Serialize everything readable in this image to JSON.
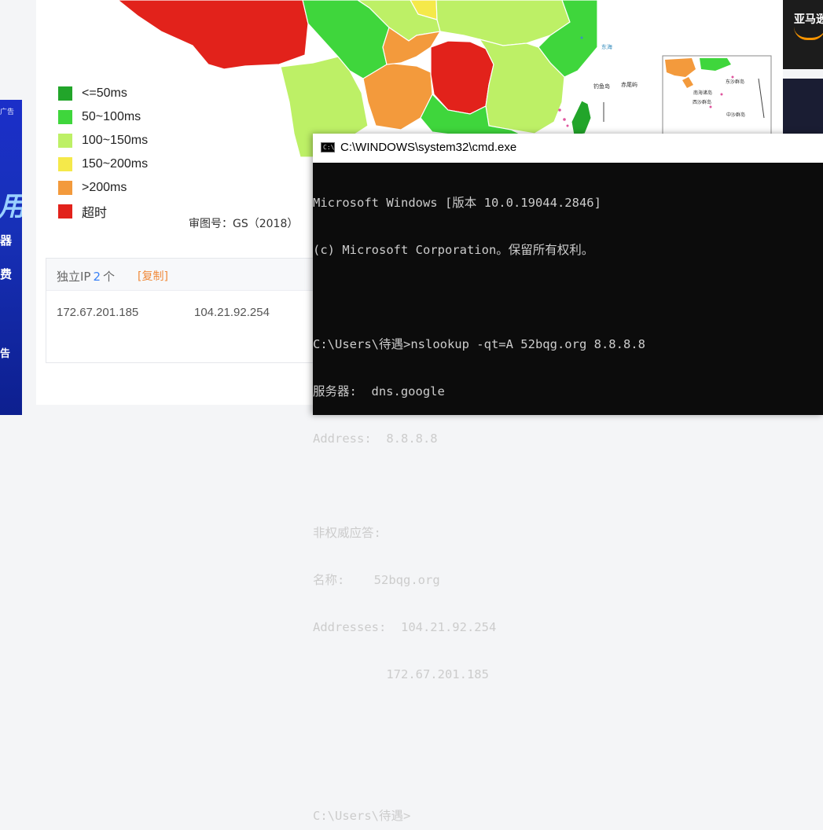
{
  "left_ad": {
    "tag": "广告",
    "big_char": "用",
    "chars": [
      "器",
      "费",
      "告"
    ]
  },
  "legend": {
    "items": [
      {
        "label": "<=50ms",
        "color": "#22a52a"
      },
      {
        "label": "50~100ms",
        "color": "#3fd63c"
      },
      {
        "label": "100~150ms",
        "color": "#bdf066"
      },
      {
        "label": "150~200ms",
        "color": "#f5e94a"
      },
      {
        "label": ">200ms",
        "color": "#f39a3c"
      },
      {
        "label": "超时",
        "color": "#e2221b"
      }
    ]
  },
  "map": {
    "review_number": "审图号：GS（2018）"
  },
  "ip_panel": {
    "title": "独立IP",
    "count": "2",
    "unit": "个",
    "copy_label": "[复制]",
    "ips": [
      "172.67.201.185",
      "104.21.92.254"
    ]
  },
  "right_ad": {
    "text": "亚马逊"
  },
  "cmd": {
    "title": "C:\\WINDOWS\\system32\\cmd.exe",
    "icon": "cmd-window-icon",
    "lines": [
      "Microsoft Windows [版本 10.0.19044.2846]",
      "(c) Microsoft Corporation。保留所有权利。",
      "",
      "C:\\Users\\待遇>nslookup -qt=A 52bqg.org 8.8.8.8",
      "服务器:  dns.google",
      "Address:  8.8.8.8",
      "",
      "非权威应答:",
      "名称:    52bqg.org",
      "Addresses:  104.21.92.254",
      "          172.67.201.185",
      "",
      "",
      "C:\\Users\\待遇>"
    ]
  }
}
